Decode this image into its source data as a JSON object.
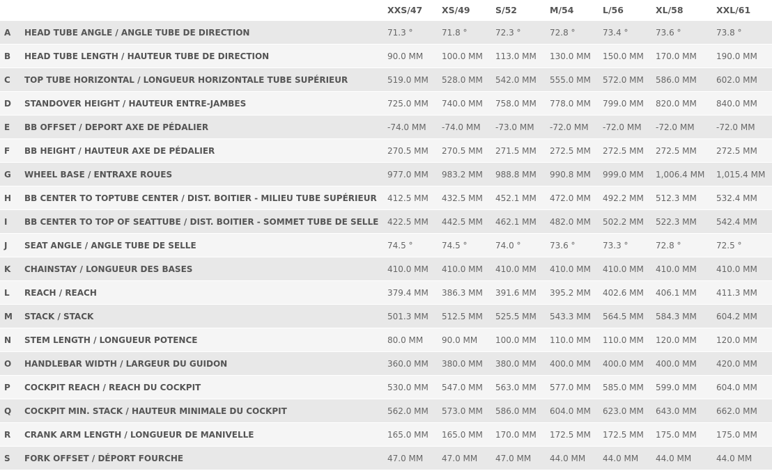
{
  "sizes": [
    "XXS/47",
    "XS/49",
    "S/52",
    "M/54",
    "L/56",
    "XL/58",
    "XXL/61"
  ],
  "rows": [
    {
      "letter": "A",
      "label": "HEAD TUBE ANGLE / ANGLE TUBE DE DIRECTION",
      "values": [
        "71.3 °",
        "71.8 °",
        "72.3 °",
        "72.8 °",
        "73.4 °",
        "73.6 °",
        "73.8 °"
      ]
    },
    {
      "letter": "B",
      "label": "HEAD TUBE LENGTH / HAUTEUR TUBE DE DIRECTION",
      "values": [
        "90.0 MM",
        "100.0 MM",
        "113.0 MM",
        "130.0 MM",
        "150.0 MM",
        "170.0 MM",
        "190.0 MM"
      ]
    },
    {
      "letter": "C",
      "label": "TOP TUBE HORIZONTAL / LONGUEUR HORIZONTALE TUBE SUPÉRIEUR",
      "values": [
        "519.0 MM",
        "528.0 MM",
        "542.0 MM",
        "555.0 MM",
        "572.0 MM",
        "586.0 MM",
        "602.0 MM"
      ]
    },
    {
      "letter": "D",
      "label": "STANDOVER HEIGHT / HAUTEUR ENTRE-JAMBES",
      "values": [
        "725.0 MM",
        "740.0 MM",
        "758.0 MM",
        "778.0 MM",
        "799.0 MM",
        "820.0 MM",
        "840.0 MM"
      ]
    },
    {
      "letter": "E",
      "label": "BB OFFSET / DEPORT AXE DE PÉDALIER",
      "values": [
        "-74.0 MM",
        "-74.0 MM",
        "-73.0 MM",
        "-72.0 MM",
        "-72.0 MM",
        "-72.0 MM",
        "-72.0 MM"
      ]
    },
    {
      "letter": "F",
      "label": "BB HEIGHT / HAUTEUR AXE DE PÉDALIER",
      "values": [
        "270.5 MM",
        "270.5 MM",
        "271.5 MM",
        "272.5 MM",
        "272.5 MM",
        "272.5 MM",
        "272.5 MM"
      ]
    },
    {
      "letter": "G",
      "label": "WHEEL BASE / ENTRAXE ROUES",
      "values": [
        "977.0 MM",
        "983.2 MM",
        "988.8 MM",
        "990.8 MM",
        "999.0 MM",
        "1,006.4 MM",
        "1,015.4 MM"
      ]
    },
    {
      "letter": "H",
      "label": "BB CENTER TO TOPTUBE CENTER / DIST. BOITIER - MILIEU TUBE SUPÉRIEUR",
      "values": [
        "412.5 MM",
        "432.5 MM",
        "452.1 MM",
        "472.0 MM",
        "492.2 MM",
        "512.3 MM",
        "532.4 MM"
      ]
    },
    {
      "letter": "I",
      "label": "BB CENTER TO TOP OF SEATTUBE / DIST. BOITIER - SOMMET TUBE DE SELLE",
      "values": [
        "422.5 MM",
        "442.5 MM",
        "462.1 MM",
        "482.0 MM",
        "502.2 MM",
        "522.3 MM",
        "542.4 MM"
      ]
    },
    {
      "letter": "J",
      "label": "SEAT ANGLE / ANGLE TUBE DE SELLE",
      "values": [
        "74.5 °",
        "74.5 °",
        "74.0 °",
        "73.6 °",
        "73.3 °",
        "72.8 °",
        "72.5 °"
      ]
    },
    {
      "letter": "K",
      "label": "CHAINSTAY / LONGUEUR DES BASES",
      "values": [
        "410.0 MM",
        "410.0 MM",
        "410.0 MM",
        "410.0 MM",
        "410.0 MM",
        "410.0 MM",
        "410.0 MM"
      ]
    },
    {
      "letter": "L",
      "label": "REACH / REACH",
      "values": [
        "379.4 MM",
        "386.3 MM",
        "391.6 MM",
        "395.2 MM",
        "402.6 MM",
        "406.1 MM",
        "411.3 MM"
      ]
    },
    {
      "letter": "M",
      "label": "STACK / STACK",
      "values": [
        "501.3 MM",
        "512.5 MM",
        "525.5 MM",
        "543.3 MM",
        "564.5 MM",
        "584.3 MM",
        "604.2 MM"
      ]
    },
    {
      "letter": "N",
      "label": "STEM LENGTH / LONGUEUR POTENCE",
      "values": [
        "80.0 MM",
        "90.0 MM",
        "100.0 MM",
        "110.0 MM",
        "110.0 MM",
        "120.0 MM",
        "120.0 MM"
      ]
    },
    {
      "letter": "O",
      "label": "HANDLEBAR WIDTH / LARGEUR DU GUIDON",
      "values": [
        "360.0 MM",
        "380.0 MM",
        "380.0 MM",
        "400.0 MM",
        "400.0 MM",
        "400.0 MM",
        "420.0 MM"
      ]
    },
    {
      "letter": "P",
      "label": "COCKPIT REACH / REACH DU COCKPIT",
      "values": [
        "530.0 MM",
        "547.0 MM",
        "563.0 MM",
        "577.0 MM",
        "585.0 MM",
        "599.0 MM",
        "604.0 MM"
      ]
    },
    {
      "letter": "Q",
      "label": "COCKPIT MIN. STACK / HAUTEUR MINIMALE DU COCKPIT",
      "values": [
        "562.0 MM",
        "573.0 MM",
        "586.0 MM",
        "604.0 MM",
        "623.0 MM",
        "643.0 MM",
        "662.0 MM"
      ]
    },
    {
      "letter": "R",
      "label": "CRANK ARM LENGTH / LONGUEUR DE MANIVELLE",
      "values": [
        "165.0 MM",
        "165.0 MM",
        "170.0 MM",
        "172.5 MM",
        "172.5 MM",
        "175.0 MM",
        "175.0 MM"
      ]
    },
    {
      "letter": "S",
      "label": "FORK OFFSET / DÉPORT FOURCHE",
      "values": [
        "47.0 MM",
        "47.0 MM",
        "47.0 MM",
        "44.0 MM",
        "44.0 MM",
        "44.0 MM",
        "44.0 MM"
      ]
    }
  ]
}
